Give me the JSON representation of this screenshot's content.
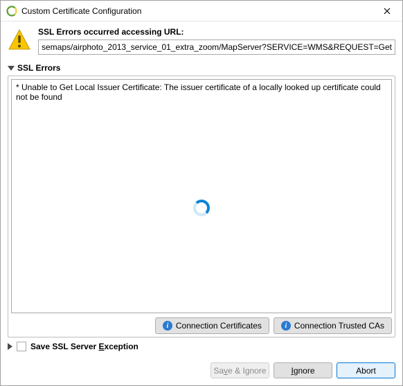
{
  "window": {
    "title": "Custom Certificate Configuration"
  },
  "url_section": {
    "label": "SSL Errors occurred accessing URL:",
    "value": "semaps/airphoto_2013_service_01_extra_zoom/MapServer?SERVICE=WMS&REQUEST=GetCapabilities"
  },
  "ssl_errors": {
    "header": "SSL Errors",
    "message": "* Unable to Get Local Issuer Certificate: The issuer certificate of a locally looked up certificate could not be found",
    "buttons": {
      "conn_certs": "Connection Certificates",
      "conn_trusted": "Connection Trusted CAs"
    }
  },
  "save_section": {
    "label_pre": "Save SSL Server ",
    "label_underlined": "E",
    "label_post": "xception"
  },
  "footer": {
    "save_ignore_pre": "Sa",
    "save_ignore_u": "v",
    "save_ignore_post": "e & Ignore",
    "ignore_u": "I",
    "ignore_post": "gnore",
    "abort": "Abort"
  }
}
